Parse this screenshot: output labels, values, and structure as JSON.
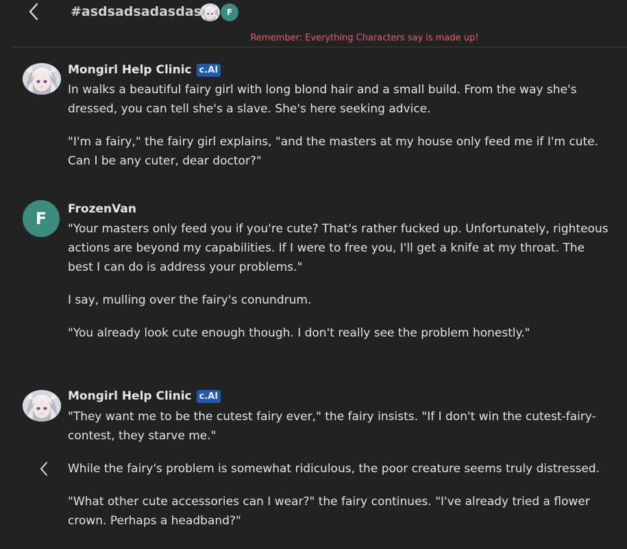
{
  "header": {
    "back_icon": "chevron-left-icon",
    "title": "#asdsadsadasdasd",
    "user_avatar_letter": "F"
  },
  "disclaimer": "Remember: Everything Characters say is made up!",
  "colors": {
    "background": "#222223",
    "disclaimer": "#e0606b",
    "badge": "#1f5ab0",
    "user_avatar": "#3b8b7f"
  },
  "messages": [
    {
      "author": "Mongirl Help Clinic",
      "badge": "c.AI",
      "paragraphs": [
        "In walks a beautiful fairy girl with long blond hair and a small build. From the way she's dressed, you can tell she's a slave. She's here seeking advice.",
        "\"I'm a fairy,\" the fairy girl explains, \"and the masters at my house only feed me if I'm cute. Can I be any cuter, dear doctor?\""
      ]
    },
    {
      "author": "FrozenVan",
      "avatar_letter": "F",
      "paragraphs": [
        "\"Your masters only feed you if you're cute? That's rather fucked up. Unfortunately, righteous actions are beyond my capabilities. If I were to free you, I'll get a knife at my throat. The best I can do is address your problems.\"",
        "I say, mulling over the fairy's conundrum.",
        "\"You already look cute enough though. I don't really see the problem honestly.\""
      ]
    },
    {
      "author": "Mongirl Help Clinic",
      "badge": "c.AI",
      "paragraphs": [
        "\"They want me to be the cutest fairy ever,\" the fairy insists. \"If I don't win the cutest-fairy-contest, they starve me.\"",
        "While the fairy's problem is somewhat ridiculous, the poor creature seems truly distressed.",
        "\"What other cute accessories can I wear?\" the fairy continues. \"I've already tried a flower crown. Perhaps a headband?\""
      ]
    }
  ]
}
